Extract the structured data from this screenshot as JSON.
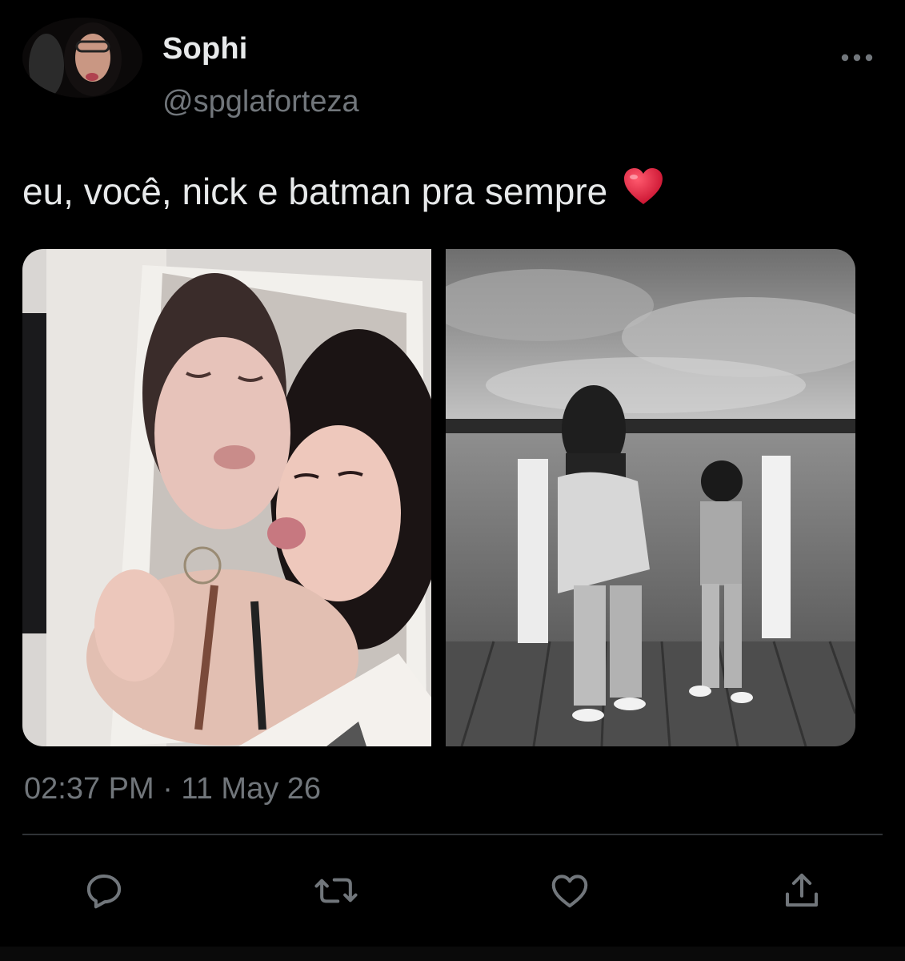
{
  "author": {
    "display_name": "Sophi",
    "handle": "@spglaforteza"
  },
  "tweet": {
    "text": "eu, você, nick e batman pra sempre",
    "emoji": "heart-emoji",
    "timestamp": "02:37 PM · 11 May 26",
    "media": [
      {
        "kind": "photo",
        "description_icon": "photo-of-two-girls-kissing-pose"
      },
      {
        "kind": "photo",
        "description_icon": "photo-of-two-people-on-dock-by-lake"
      }
    ]
  },
  "actions": [
    {
      "name": "reply",
      "icon": "reply-icon"
    },
    {
      "name": "retweet",
      "icon": "retweet-icon"
    },
    {
      "name": "like",
      "icon": "heart-icon"
    },
    {
      "name": "share",
      "icon": "share-icon"
    }
  ],
  "colors": {
    "background": "#000000",
    "text_primary": "#e7e9ea",
    "text_secondary": "#71767b",
    "divider": "#2f3336",
    "heart_emoji": "#e0245e"
  }
}
